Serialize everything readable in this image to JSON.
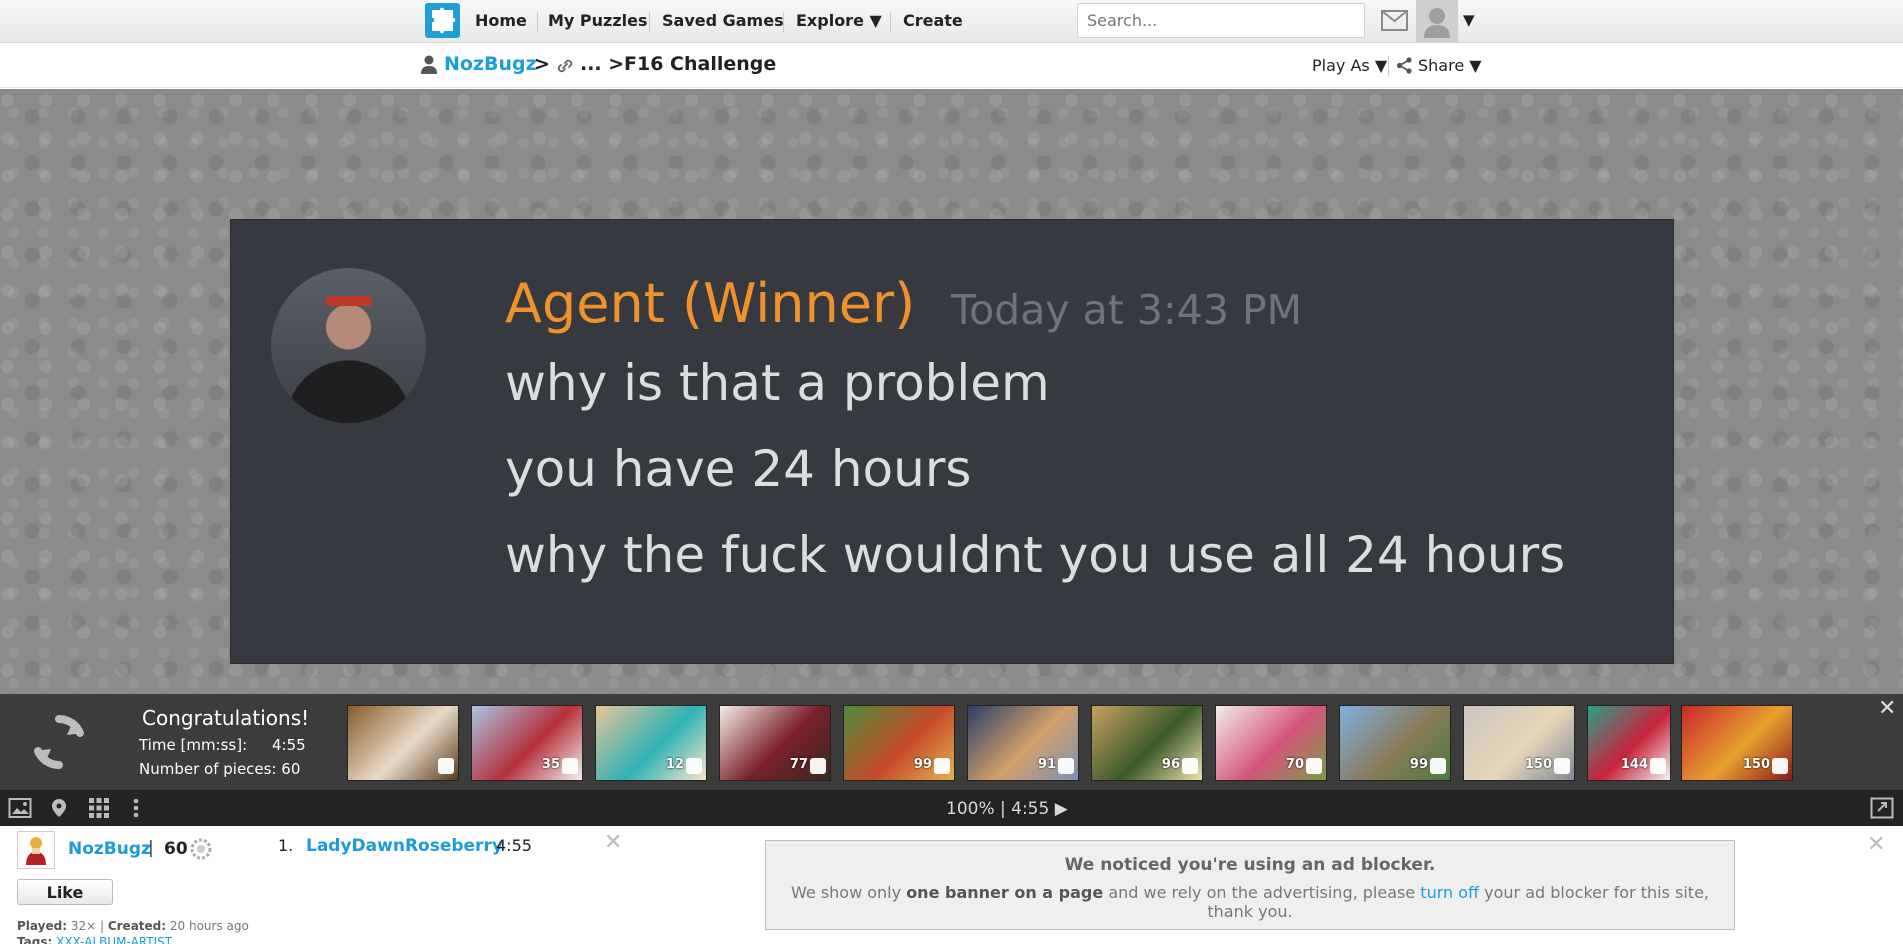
{
  "nav": {
    "items": [
      "Home",
      "My Puzzles",
      "Saved Games",
      "Explore ▼",
      "Create"
    ],
    "search_placeholder": "Search...",
    "avatar_caret": "▼"
  },
  "breadcrumb": {
    "user": "NozBugz",
    "sep1": ">",
    "ellipsis": "... >",
    "title": "F16 Challenge",
    "play_as": "Play As ▼",
    "share": "Share ▼"
  },
  "puzzle_image": {
    "name": "Agent (Winner)",
    "time": "Today at 3:43 PM",
    "lines": [
      "why is that a problem",
      "you have 24 hours",
      "why the fuck wouldnt you use all 24 hours"
    ]
  },
  "congrats": {
    "title": "Congratulations!",
    "time_label": "Time [mm:ss]:",
    "time_value": "4:55",
    "pieces_label": "Number of pieces: 60",
    "close": "✕",
    "thumbnails": [
      {
        "count": "",
        "colors": [
          "#8a5a2b",
          "#e8dcc8",
          "#5b3a1c"
        ]
      },
      {
        "count": "35",
        "colors": [
          "#a9c6e3",
          "#b5303a",
          "#f1f1f1"
        ]
      },
      {
        "count": "12",
        "colors": [
          "#e9c596",
          "#2fb2b5",
          "#f6e7c9"
        ]
      },
      {
        "count": "77",
        "colors": [
          "#f4ede4",
          "#7a1f2a",
          "#3a2a22"
        ]
      },
      {
        "count": "99",
        "colors": [
          "#4f8d3a",
          "#c44a2a",
          "#e6b050"
        ]
      },
      {
        "count": "91",
        "colors": [
          "#2c3f6a",
          "#d3a06a",
          "#7b8fb8"
        ]
      },
      {
        "count": "96",
        "colors": [
          "#c8a060",
          "#3a5a2a",
          "#f0e0b0"
        ]
      },
      {
        "count": "70",
        "colors": [
          "#f4ede8",
          "#d4567a",
          "#7c9b4a"
        ]
      },
      {
        "count": "99",
        "colors": [
          "#7fb0df",
          "#8a7a5a",
          "#4a7a3a"
        ]
      },
      {
        "count": "150",
        "colors": [
          "#c9c5c0",
          "#e9d6b8",
          "#7f8a98"
        ]
      },
      {
        "count": "144",
        "colors": [
          "#2aa08a",
          "#c8233a",
          "#f3f3f3"
        ]
      },
      {
        "count": "150",
        "colors": [
          "#c7282a",
          "#e8a030",
          "#8a1a1a"
        ]
      }
    ]
  },
  "toolbar": {
    "zoom_time": "100% | 4:55 ▶"
  },
  "bottom": {
    "author": "NozBugz",
    "sep": "|",
    "score": "60",
    "like": "Like",
    "played_label": "Played:",
    "played_value": "32×",
    "created_label": "Created:",
    "created_value": "20 hours ago",
    "tags_label": "Tags:",
    "tags_value": "XXX-ALBUM-ARTIST",
    "leaderboard": [
      {
        "rank": "1.",
        "name": "LadyDawnRoseberry",
        "time": "4:55"
      }
    ],
    "close": "✕"
  },
  "ad_notice": {
    "title": "We noticed you're using an ad blocker.",
    "text_a": "We show only",
    "text_b": "one banner on a page",
    "text_c": "and we rely on the advertising, please",
    "text_link": "turn off",
    "text_d": "your ad blocker for this site, thank you.",
    "close": "✕"
  }
}
